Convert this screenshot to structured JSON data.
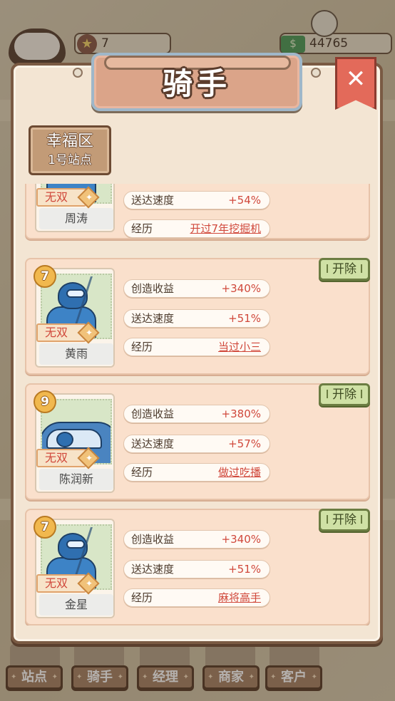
{
  "hud": {
    "stars": "7",
    "cash": "44765",
    "star_icon": "star-icon",
    "cash_icon": "cash-icon"
  },
  "modal": {
    "title": "骑手",
    "close_icon": "fork-knife-close-icon",
    "district_line1": "幸福区",
    "district_line2": "1号站点"
  },
  "riders": [
    {
      "name": "周涛",
      "tag": "无双",
      "level": "",
      "speed_label": "送达速度",
      "speed_value": "+54%",
      "history_label": "经历",
      "history_value": "开过7年挖掘机"
    },
    {
      "name": "黄雨",
      "tag": "无双",
      "level": "7",
      "income_label": "创造收益",
      "income_value": "+340%",
      "speed_label": "送达速度",
      "speed_value": "+51%",
      "history_label": "经历",
      "history_value": "当过小三",
      "fire_label": "开除"
    },
    {
      "name": "陈润新",
      "tag": "无双",
      "level": "9",
      "income_label": "创造收益",
      "income_value": "+380%",
      "speed_label": "送达速度",
      "speed_value": "+57%",
      "history_label": "经历",
      "history_value": "做过吃播",
      "fire_label": "开除"
    },
    {
      "name": "金星",
      "tag": "无双",
      "level": "7",
      "income_label": "创造收益",
      "income_value": "+340%",
      "speed_label": "送达速度",
      "speed_value": "+51%",
      "history_label": "经历",
      "history_value": "麻将高手",
      "fire_label": "开除"
    }
  ],
  "bottom_nav": {
    "tabs": [
      "站点",
      "骑手",
      "经理",
      "商家",
      "客户"
    ]
  },
  "colors": {
    "panel": "#f3e5d3",
    "card": "#fae0cc",
    "accent_red": "#d0483b",
    "fire_button": "#cfe1a5"
  }
}
